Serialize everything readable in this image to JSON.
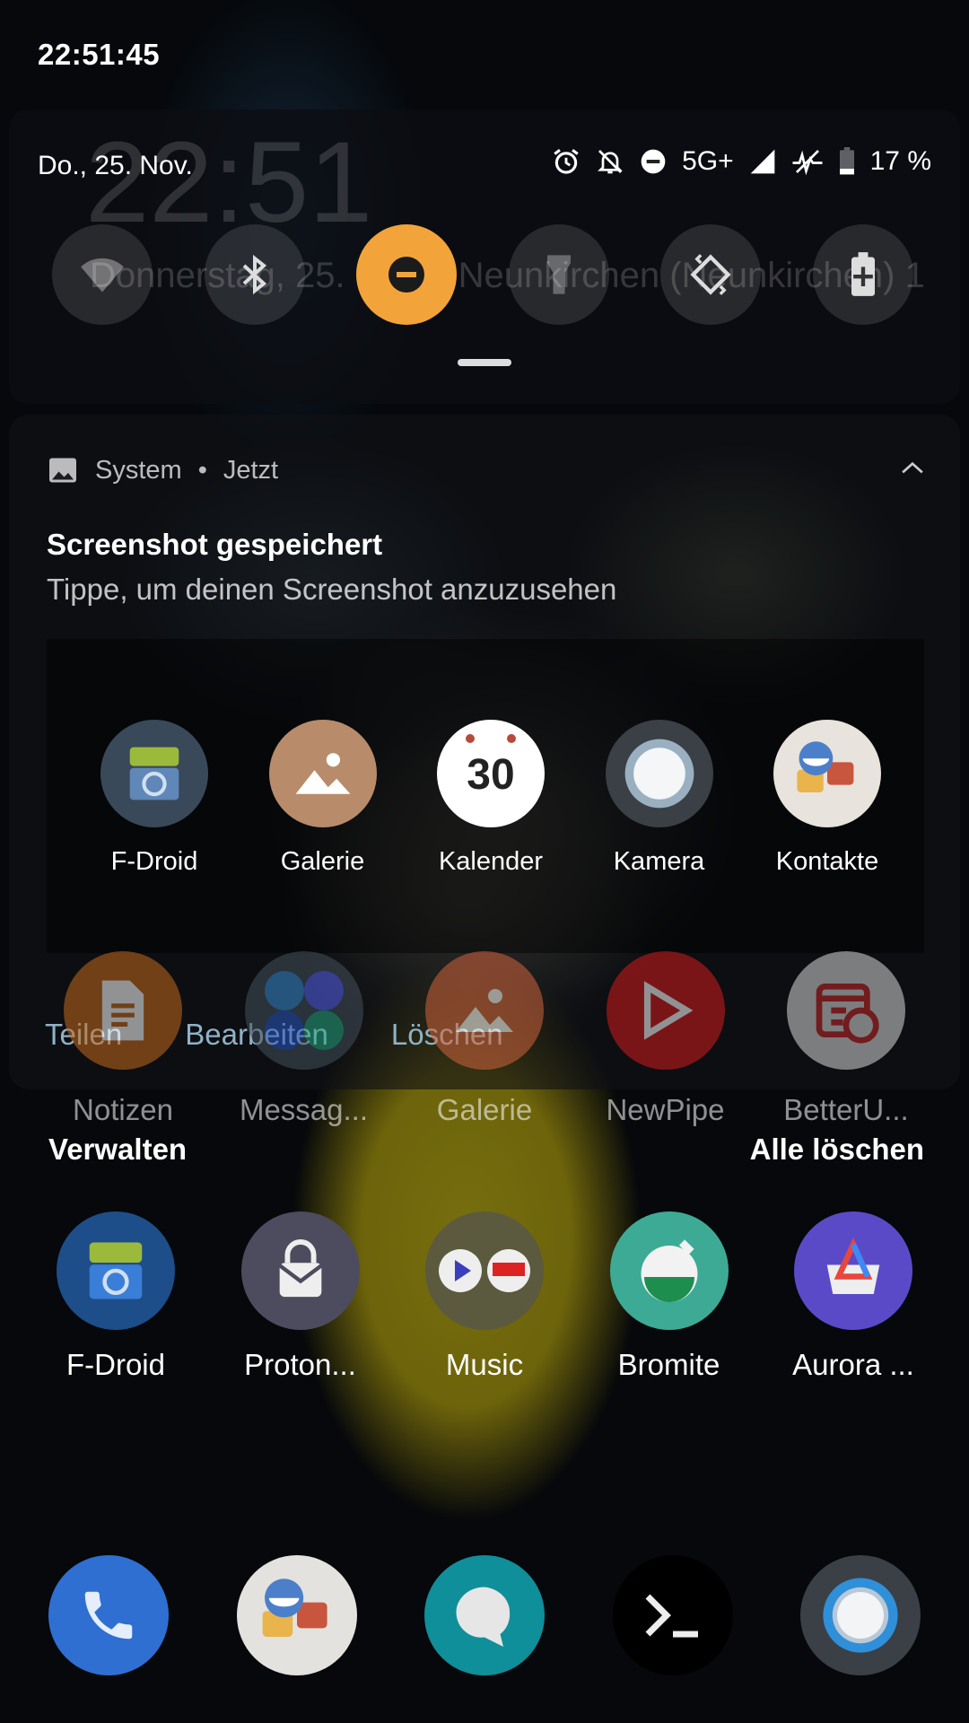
{
  "status_bar": {
    "time": "22:51:45"
  },
  "quick_settings": {
    "date": "Do., 25. Nov.",
    "network": "5G+",
    "battery": "17 %",
    "lockscreen_time": "22:51",
    "lockscreen_date": "Donnerstag, 25. Nov. · Neunkirchen (Neunkirchen) 1",
    "tiles": [
      {
        "name": "wifi",
        "active": false
      },
      {
        "name": "bluetooth",
        "active": false
      },
      {
        "name": "do-not-disturb",
        "active": true
      },
      {
        "name": "flashlight",
        "active": false
      },
      {
        "name": "auto-rotate",
        "active": false
      },
      {
        "name": "battery-saver",
        "active": false
      }
    ],
    "accent": "#f2a43a"
  },
  "notification": {
    "app": "System",
    "time": "Jetzt",
    "title": "Screenshot gespeichert",
    "text": "Tippe, um deinen Screenshot anzuzusehen",
    "preview_apps": [
      {
        "label": "F-Droid",
        "icon": "fdroid-icon"
      },
      {
        "label": "Galerie",
        "icon": "gallery-icon"
      },
      {
        "label": "Kalender",
        "icon": "calendar-icon",
        "badge": "30"
      },
      {
        "label": "Kamera",
        "icon": "camera-icon"
      },
      {
        "label": "Kontakte",
        "icon": "contacts-icon"
      }
    ],
    "actions": [
      "Teilen",
      "Bearbeiten",
      "Löschen"
    ]
  },
  "home": {
    "row1": [
      {
        "label": "Notizen",
        "icon": "notes-icon"
      },
      {
        "label": "Messag...",
        "icon": "messaging-folder-icon"
      },
      {
        "label": "Galerie",
        "icon": "gallery-icon"
      },
      {
        "label": "NewPipe",
        "icon": "newpipe-icon"
      },
      {
        "label": "BetterU...",
        "icon": "betteruntis-icon"
      }
    ],
    "manage": "Verwalten",
    "clear_all": "Alle löschen",
    "row2": [
      {
        "label": "F-Droid",
        "icon": "fdroid-icon"
      },
      {
        "label": "Proton...",
        "icon": "protonmail-icon"
      },
      {
        "label": "Music",
        "icon": "music-folder-icon"
      },
      {
        "label": "Bromite",
        "icon": "bromite-icon"
      },
      {
        "label": "Aurora ...",
        "icon": "aurora-store-icon"
      }
    ],
    "dock": [
      {
        "icon": "phone-icon"
      },
      {
        "icon": "contacts-icon"
      },
      {
        "icon": "messages-icon"
      },
      {
        "icon": "terminal-icon"
      },
      {
        "icon": "camera-icon"
      }
    ]
  }
}
